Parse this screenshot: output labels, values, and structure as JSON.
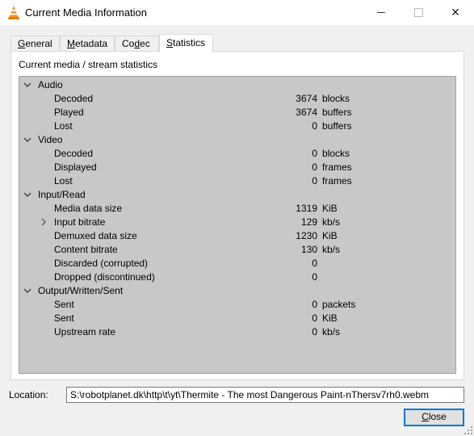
{
  "window": {
    "title": "Current Media Information"
  },
  "tabs": [
    {
      "label": "General",
      "underline": "G",
      "rest": "eneral"
    },
    {
      "label": "Metadata",
      "underline": "M",
      "rest": "etadata"
    },
    {
      "label": "Codec",
      "pre": "Co",
      "underline": "d",
      "rest": "ec"
    },
    {
      "label": "Statistics",
      "underline": "S",
      "rest": "tatistics"
    }
  ],
  "active_tab": "Statistics",
  "section_title": "Current media / stream statistics",
  "stats": [
    {
      "category": "Audio",
      "items": [
        {
          "label": "Decoded",
          "value": "3674",
          "unit": "blocks"
        },
        {
          "label": "Played",
          "value": "3674",
          "unit": "buffers"
        },
        {
          "label": "Lost",
          "value": "0",
          "unit": "buffers"
        }
      ]
    },
    {
      "category": "Video",
      "items": [
        {
          "label": "Decoded",
          "value": "0",
          "unit": "blocks"
        },
        {
          "label": "Displayed",
          "value": "0",
          "unit": "frames"
        },
        {
          "label": "Lost",
          "value": "0",
          "unit": "frames"
        }
      ]
    },
    {
      "category": "Input/Read",
      "items": [
        {
          "label": "Media data size",
          "value": "1319",
          "unit": "KiB"
        },
        {
          "label": "Input bitrate",
          "value": "129",
          "unit": "kb/s",
          "expandable": true
        },
        {
          "label": "Demuxed data size",
          "value": "1230",
          "unit": "KiB"
        },
        {
          "label": "Content bitrate",
          "value": "130",
          "unit": "kb/s"
        },
        {
          "label": "Discarded (corrupted)",
          "value": "0",
          "unit": ""
        },
        {
          "label": "Dropped (discontinued)",
          "value": "0",
          "unit": ""
        }
      ]
    },
    {
      "category": "Output/Written/Sent",
      "items": [
        {
          "label": "Sent",
          "value": "0",
          "unit": "packets"
        },
        {
          "label": "Sent",
          "value": "0",
          "unit": "KiB"
        },
        {
          "label": "Upstream rate",
          "value": "0",
          "unit": "kb/s"
        }
      ]
    }
  ],
  "location": {
    "label": "Location:",
    "value": "S:\\robotplanet.dk\\http\\t\\yt\\Thermite - The most Dangerous Paint-nThersv7rh0.webm"
  },
  "buttons": {
    "close": {
      "underline": "C",
      "rest": "lose",
      "label": "Close"
    }
  },
  "colors": {
    "accent": "#0078d7",
    "tree_bg": "#c8c8c8",
    "icon_orange": "#f7931e"
  }
}
